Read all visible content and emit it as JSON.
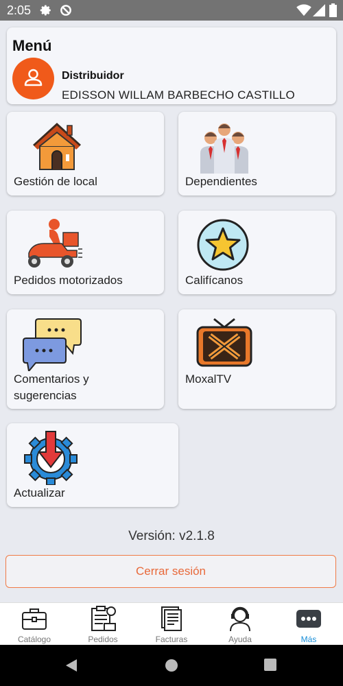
{
  "status_bar": {
    "time": "2:05"
  },
  "menu": {
    "title": "Menú",
    "role": "Distribuidor",
    "user_name": "EDISSON WILLAM BARBECHO CASTILLO"
  },
  "tiles": [
    {
      "label": "Gestión de local",
      "icon": "house-icon"
    },
    {
      "label": "Dependientes",
      "icon": "people-icon"
    },
    {
      "label": "Pedidos motorizados",
      "icon": "delivery-scooter-icon"
    },
    {
      "label": "Califícanos",
      "icon": "star-icon"
    },
    {
      "label_line1": "Comentarios y",
      "label_line2": "sugerencias",
      "icon": "chat-bubbles-icon"
    },
    {
      "label": "MoxalTV",
      "icon": "tv-icon"
    },
    {
      "label": "Actualizar",
      "icon": "update-gear-icon"
    }
  ],
  "version": "Versión: v2.1.8",
  "logout_label": "Cerrar sesión",
  "bottom_nav": [
    {
      "label": "Catálogo",
      "icon": "briefcase-icon"
    },
    {
      "label": "Pedidos",
      "icon": "clipboard-icon"
    },
    {
      "label": "Facturas",
      "icon": "invoice-icon"
    },
    {
      "label": "Ayuda",
      "icon": "support-agent-icon"
    },
    {
      "label": "Más",
      "icon": "more-dots-icon",
      "active": true
    }
  ],
  "colors": {
    "accent": "#f05a1a",
    "active_nav": "#1a8fd8",
    "background": "#e8eaf0"
  }
}
